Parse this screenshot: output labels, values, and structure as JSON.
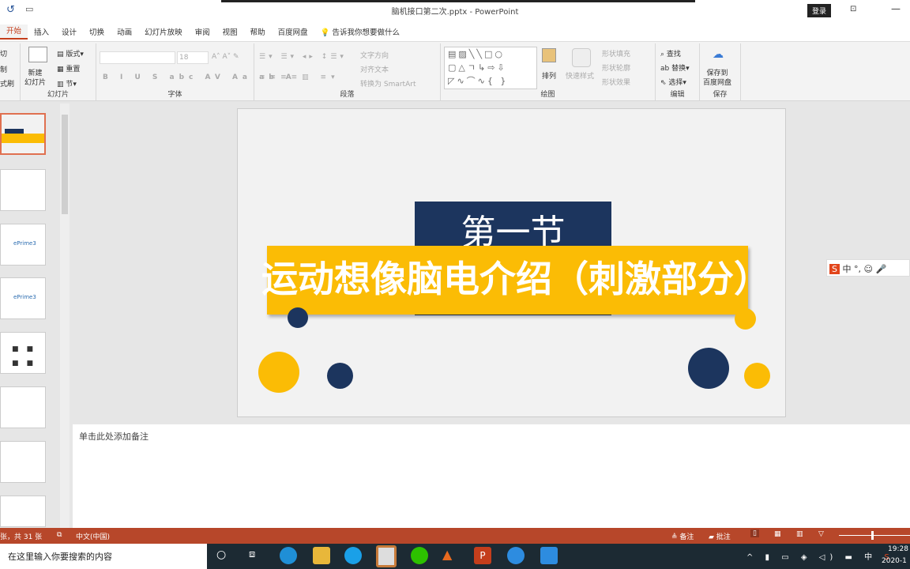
{
  "titlebar": {
    "title": "脑机接口第二次.pptx  -  PowerPoint",
    "login": "登录"
  },
  "tabs": [
    "开始",
    "插入",
    "设计",
    "切换",
    "动画",
    "幻灯片放映",
    "审阅",
    "视图",
    "帮助",
    "百度网盘"
  ],
  "tell_me": "告诉我你想要做什么",
  "ribbon": {
    "clipboard": {
      "cut": "切",
      "copy": "制",
      "painter": "式刷"
    },
    "slides": {
      "new_slide": "新建\n幻灯片",
      "layout": "版式",
      "reset": "重置",
      "section": "节",
      "label": "幻灯片"
    },
    "font": {
      "size": "18",
      "label": "字体"
    },
    "paragraph": {
      "text_dir": "文字方向",
      "align_text": "对齐文本",
      "smartart": "转换为 SmartArt",
      "label": "段落"
    },
    "drawing": {
      "arrange": "排列",
      "quick_styles": "快速样式",
      "fill": "形状填充",
      "outline": "形状轮廓",
      "effects": "形状效果",
      "label": "绘图"
    },
    "editing": {
      "find": "查找",
      "replace": "替换",
      "select": "选择",
      "label": "编辑"
    },
    "save": {
      "save_baidu": "保存到\n百度网盘",
      "label": "保存"
    }
  },
  "slide": {
    "title": "第一节",
    "subtitle": "运动想像脑电介绍（刺激部分）"
  },
  "notes_placeholder": "单击此处添加备注",
  "status": {
    "slide_count": "张，共 31 张",
    "language": "中文(中国)",
    "notes": "备注",
    "comments": "批注"
  },
  "taskbar": {
    "search": "在这里输入你要搜索的内容",
    "time": "19:28",
    "date": "2020-1"
  },
  "ime": "中",
  "colors": {
    "accent": "#b7472a",
    "navy": "#1c355e",
    "yellow": "#fbbc05"
  }
}
